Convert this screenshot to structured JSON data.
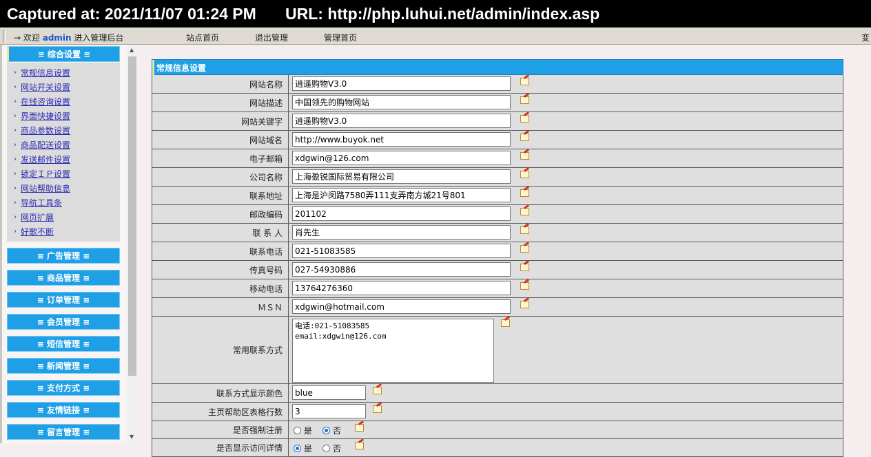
{
  "capture": {
    "time": "Captured at: 2021/11/07 01:24 PM",
    "url": "URL: http://php.luhui.net/admin/index.asp"
  },
  "topnav": {
    "arrow": "→",
    "welcome_prefix": "欢迎",
    "user": "admin",
    "welcome_suffix": "进入管理后台",
    "site_home": "站点首页",
    "logout": "退出管理",
    "admin_home": "管理首页",
    "right_text": "变"
  },
  "sidebar": {
    "heads": [
      "≡ 综合设置 ≡",
      "≡ 广告管理 ≡",
      "≡ 商品管理 ≡",
      "≡ 订单管理 ≡",
      "≡ 会员管理 ≡",
      "≡ 短信管理 ≡",
      "≡ 新闻管理 ≡",
      "≡ 支付方式 ≡",
      "≡ 友情链接 ≡",
      "≡ 留言管理 ≡"
    ],
    "bullet": "›",
    "items": [
      "常规信息设置",
      "网站开关设置",
      "在线咨询设置",
      "界面快捷设置",
      "商品参数设置",
      "商品配送设置",
      "发送邮件设置",
      "锁定ＩＰ设置",
      "网站帮助信息",
      "导航工具条",
      "网页扩展",
      "好歌不断"
    ]
  },
  "main": {
    "section_title": "常规信息设置",
    "fields": [
      {
        "label": "网站名称",
        "value": "逍遥购物V3.0"
      },
      {
        "label": "网站描述",
        "value": "中国领先的购物网站"
      },
      {
        "label": "网站关键字",
        "value": "逍遥购物V3.0"
      },
      {
        "label": "网站域名",
        "value": "http://www.buyok.net"
      },
      {
        "label": "电子邮箱",
        "value": "xdgwin@126.com"
      },
      {
        "label": "公司名称",
        "value": "上海盈锐国际贸易有限公司"
      },
      {
        "label": "联系地址",
        "value": "上海是沪闵路7580弄111支弄南方城21号801"
      },
      {
        "label": "邮政编码",
        "value": "201102"
      },
      {
        "label": "联 系 人",
        "value": "肖先生"
      },
      {
        "label": "联系电话",
        "value": "021-51083585"
      },
      {
        "label": "传真号码",
        "value": "027-54930886"
      },
      {
        "label": "移动电话",
        "value": "13764276360"
      },
      {
        "label": "ＭＳＮ",
        "value": "xdgwin@hotmail.com"
      }
    ],
    "contact": {
      "label": "常用联系方式",
      "value": "电话:021-51083585\nemail:xdgwin@126.com"
    },
    "color_field": {
      "label": "联系方式显示颜色",
      "value": "blue"
    },
    "rows_field": {
      "label": "主页帮助区表格行数",
      "value": "3"
    },
    "force_register": {
      "label": "是否强制注册",
      "yes": "是",
      "no": "否",
      "selected": "no"
    },
    "cut_row": {
      "label": "是否显示访问详情",
      "yes": "是",
      "no": "否"
    }
  }
}
